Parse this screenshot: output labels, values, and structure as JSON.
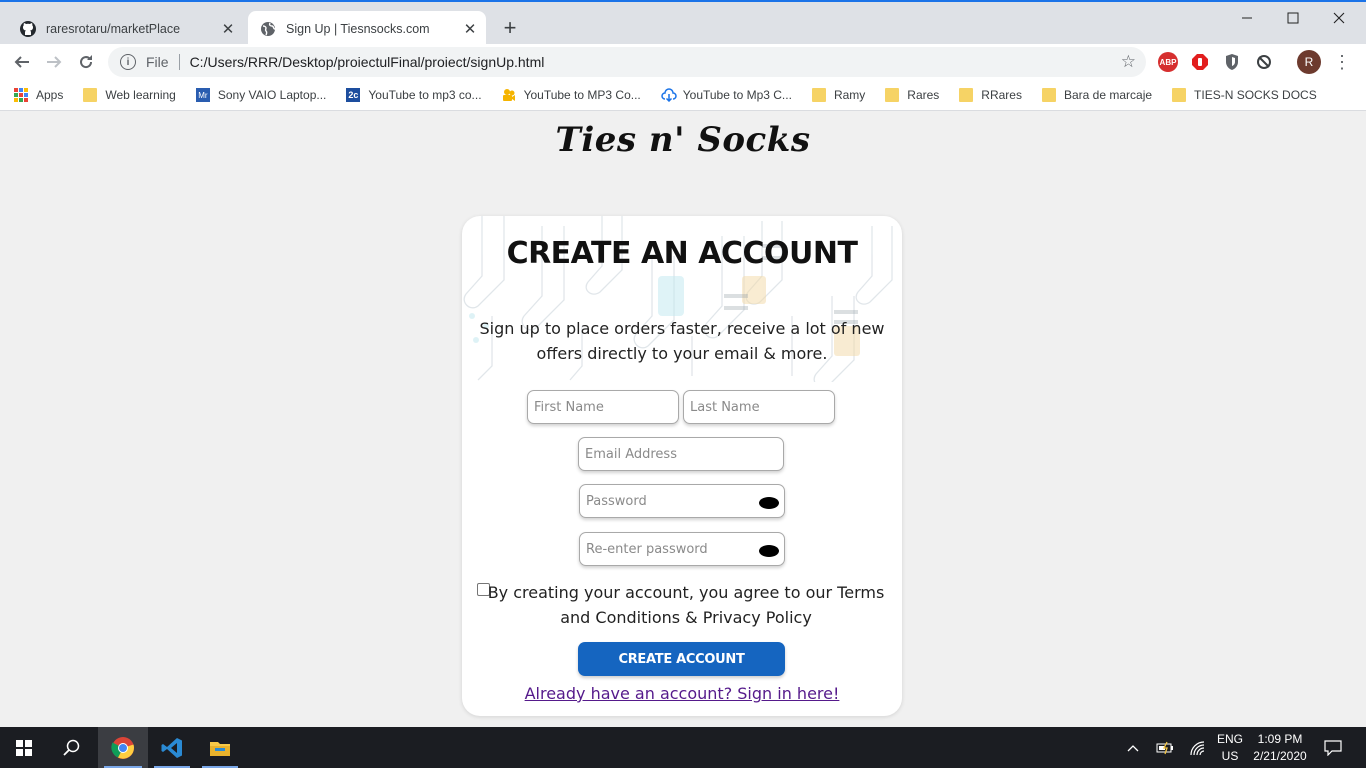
{
  "browser": {
    "tabs": [
      {
        "title": "raresrotaru/marketPlace",
        "favicon": "github-icon",
        "active": false
      },
      {
        "title": "Sign Up | Tiesnsocks.com",
        "favicon": "globe-icon",
        "active": true
      }
    ],
    "address": {
      "scheme": "File",
      "url": "C:/Users/RRR/Desktop/proiectulFinal/proiect/signUp.html"
    },
    "profile_initial": "R",
    "bookmarks": [
      {
        "label": "Apps",
        "icon": "apps-grid-icon"
      },
      {
        "label": "Web learning",
        "icon": "folder-icon"
      },
      {
        "label": "Sony VAIO Laptop...",
        "icon": "mr-site-icon",
        "icon_text": "Mr"
      },
      {
        "label": "YouTube to mp3 co...",
        "icon": "2c-site-icon",
        "icon_text": "2c"
      },
      {
        "label": "YouTube to MP3 Co...",
        "icon": "camera-site-icon"
      },
      {
        "label": "YouTube to Mp3 C...",
        "icon": "cloud-download-icon"
      },
      {
        "label": "Ramy",
        "icon": "folder-icon"
      },
      {
        "label": "Rares",
        "icon": "folder-icon"
      },
      {
        "label": "RRares",
        "icon": "folder-icon"
      },
      {
        "label": "Bara de marcaje",
        "icon": "folder-icon"
      },
      {
        "label": "TIES-N SOCKS DOCS",
        "icon": "folder-icon"
      }
    ],
    "extensions": [
      "abp-icon",
      "stop-icon",
      "shield-icon",
      "sync-icon"
    ]
  },
  "page": {
    "brand": "Ties n' Socks",
    "heading": "CREATE AN ACCOUNT",
    "subtitle": "Sign up to place orders faster, receive a lot of new offers directly to your email & more.",
    "fields": {
      "first_name": {
        "placeholder": "First Name",
        "value": ""
      },
      "last_name": {
        "placeholder": "Last Name",
        "value": ""
      },
      "email": {
        "placeholder": "Email Address",
        "value": ""
      },
      "password": {
        "placeholder": "Password",
        "value": ""
      },
      "password_confirm": {
        "placeholder": "Re-enter password",
        "value": ""
      }
    },
    "terms": "By creating your account, you agree to our Terms and Conditions & Privacy Policy",
    "terms_checked": false,
    "create_button": "CREATE ACCOUNT",
    "signin_link": "Already have an account? Sign in here!",
    "colors": {
      "button": "#1565c0",
      "link": "#551a8b",
      "background": "#f0f0f0"
    }
  },
  "taskbar": {
    "apps": [
      "start-icon",
      "search-icon",
      "chrome-icon",
      "vscode-icon",
      "file-explorer-icon"
    ],
    "active_app": "chrome-icon",
    "language": "ENG",
    "region": "US",
    "time": "1:09 PM",
    "date": "2/21/2020"
  }
}
